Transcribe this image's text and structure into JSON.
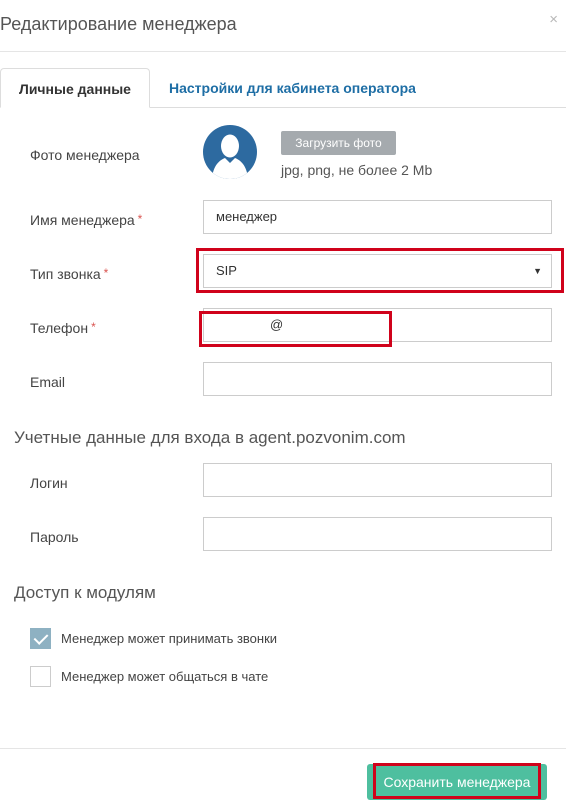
{
  "modal": {
    "title": "Редактирование менеджера",
    "close_symbol": "×"
  },
  "tabs": [
    {
      "label": "Личные данные",
      "active": true
    },
    {
      "label": "Настройки для кабинета оператора",
      "active": false
    }
  ],
  "photo": {
    "label": "Фото менеджера",
    "upload_button": "Загрузить фото",
    "hint": "jpg, png, не более 2 Mb",
    "avatar_color": "#2d6aa0"
  },
  "fields": {
    "name": {
      "label": "Имя менеджера",
      "required_mark": "*",
      "value": "менеджер"
    },
    "call_type": {
      "label": "Тип звонка",
      "required_mark": "*",
      "value": "SIP",
      "arrow": "▼"
    },
    "phone": {
      "label": "Телефон",
      "required_mark": "*",
      "value": "@"
    },
    "email": {
      "label": "Email",
      "value": ""
    }
  },
  "credentials": {
    "title": "Учетные данные для входа в agent.pozvonim.com",
    "login_label": "Логин",
    "password_label": "Пароль",
    "login_value": "",
    "password_value": ""
  },
  "modules": {
    "title": "Доступ к модулям",
    "items": [
      {
        "label": "Менеджер может принимать звонки",
        "checked": true
      },
      {
        "label": "Менеджер может общаться в чате",
        "checked": false
      }
    ]
  },
  "footer": {
    "save_label": "Сохранить менеджера"
  },
  "colors": {
    "accent_green": "#4ebf9f",
    "link_blue": "#1e6ea5",
    "highlight_red": "#d0021b",
    "checkbox_checked": "#8eb1c2"
  }
}
